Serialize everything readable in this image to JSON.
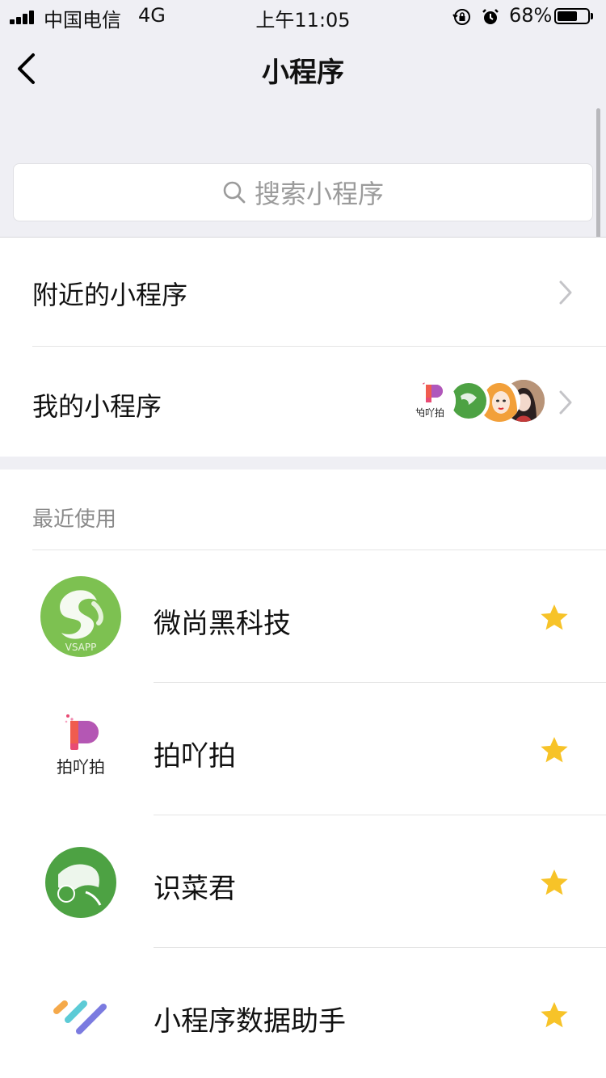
{
  "status_bar": {
    "carrier": "中国电信",
    "network": "4G",
    "time": "上午11:05",
    "battery_percent": "68%",
    "battery_level": 0.68
  },
  "nav": {
    "title": "小程序"
  },
  "search": {
    "placeholder": "搜索小程序"
  },
  "menu": {
    "nearby_label": "附近的小程序",
    "mine_label": "我的小程序",
    "mine_avatar_text": "拍吖拍"
  },
  "recent": {
    "title": "最近使用",
    "items": [
      {
        "name": "微尚黑科技",
        "icon": "vsapp-logo",
        "icon_text": "VSAPP",
        "starred": true
      },
      {
        "name": "拍吖拍",
        "icon": "paiyapai-logo",
        "icon_text": "拍吖拍",
        "starred": true
      },
      {
        "name": "识菜君",
        "icon": "shicaijun-logo",
        "starred": true
      },
      {
        "name": "小程序数据助手",
        "icon": "data-assistant-logo",
        "starred": true
      }
    ]
  },
  "colors": {
    "header_bg": "#efeff4",
    "star": "#f7c328",
    "vsapp_green": "#7dc151",
    "veg_green": "#4da243"
  }
}
